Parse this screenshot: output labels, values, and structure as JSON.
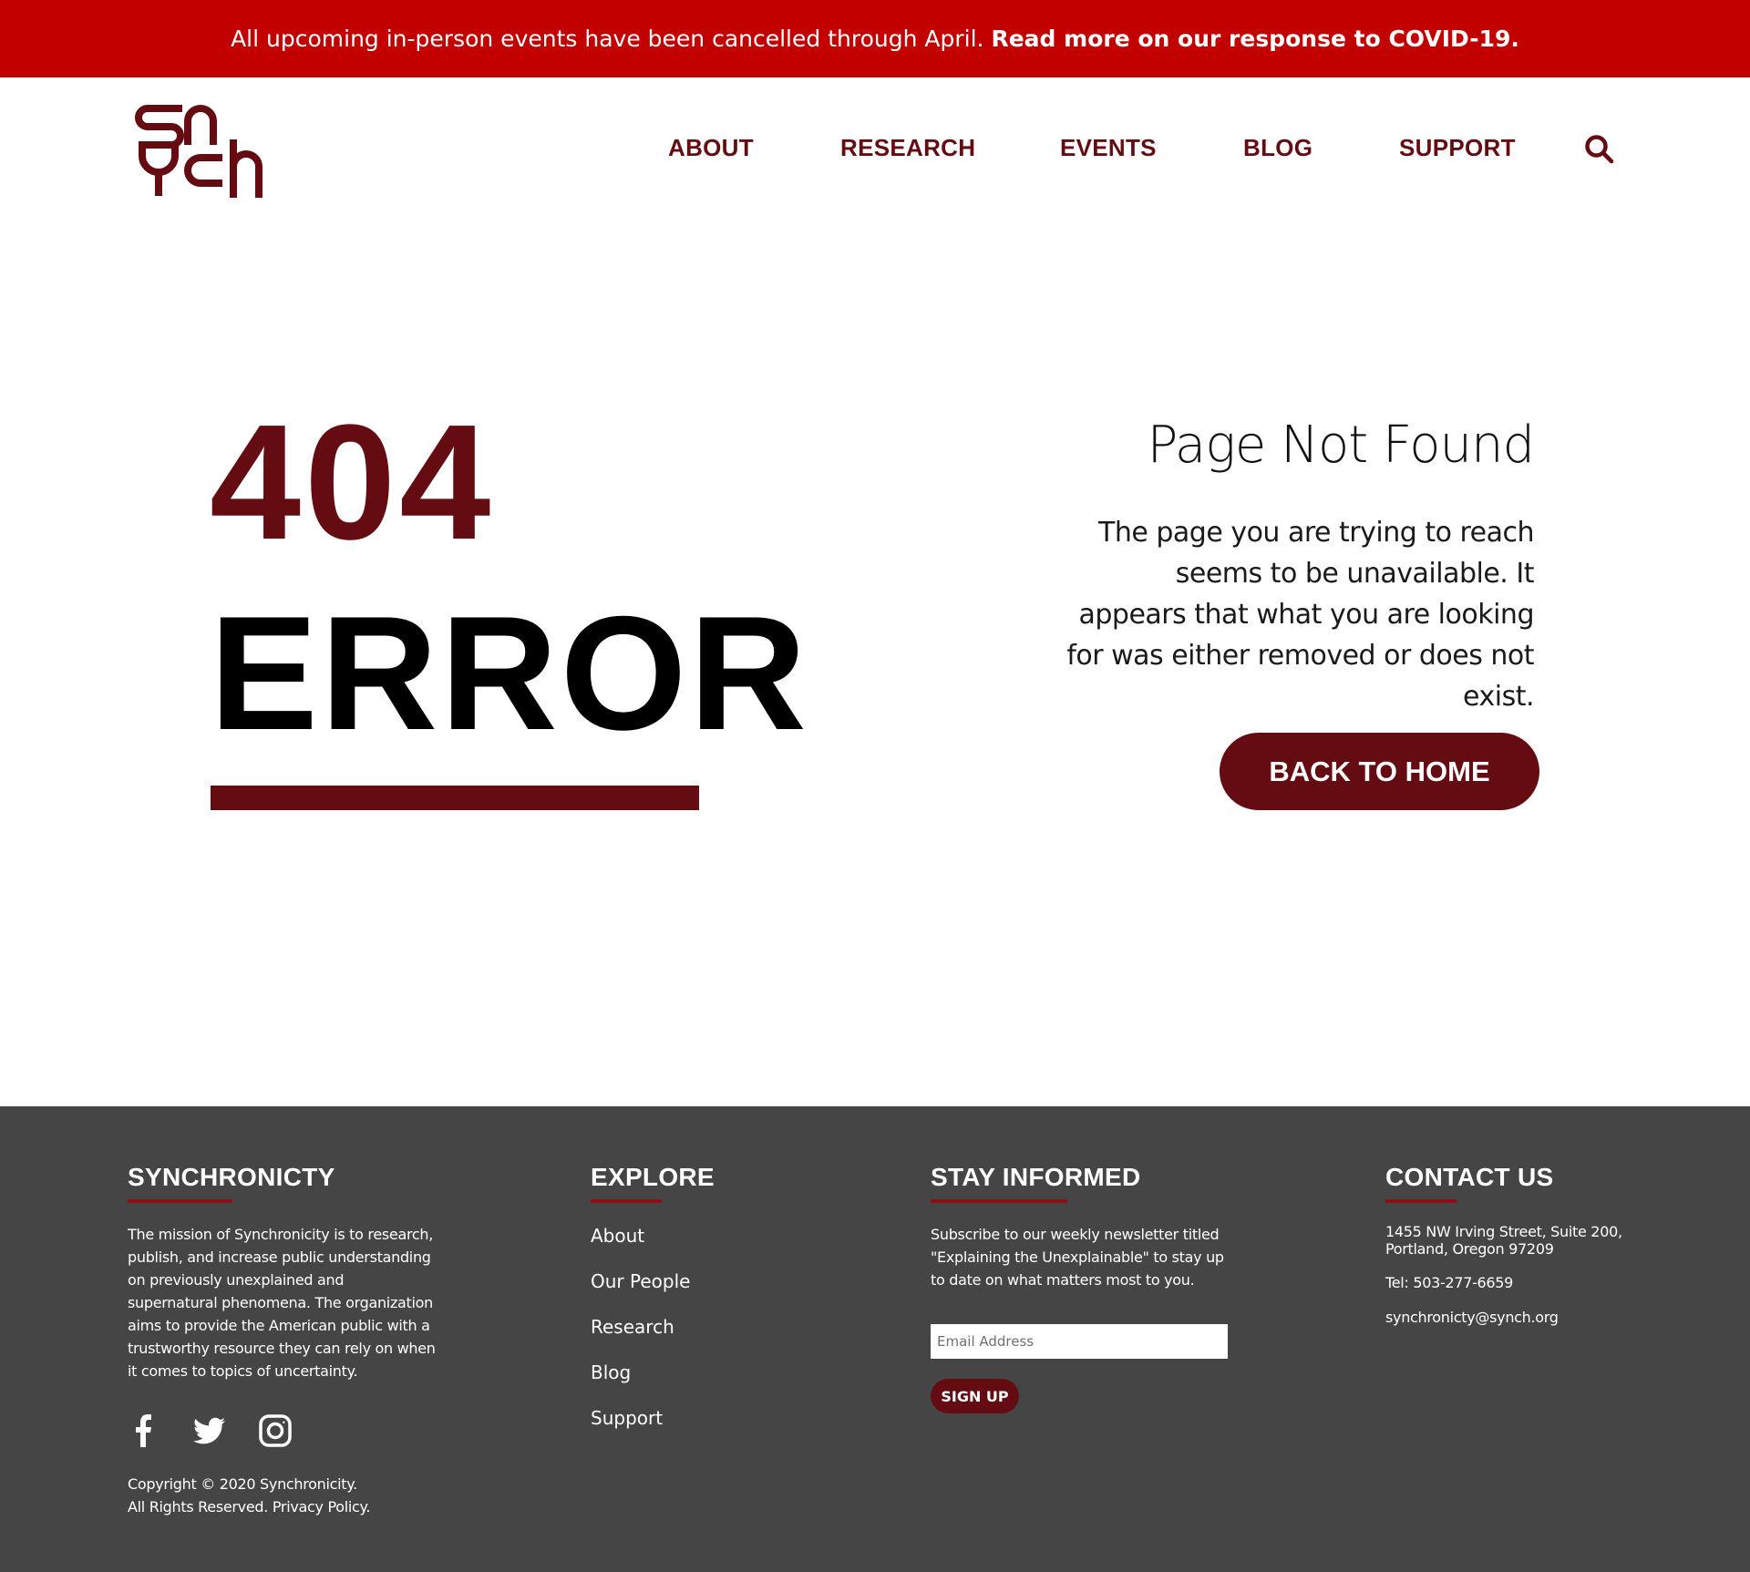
{
  "banner": {
    "message": "All upcoming in-person events have been cancelled through April.",
    "link": "Read more on our response to COVID-19."
  },
  "header": {
    "logo_alt": "Synch",
    "nav": [
      {
        "label": "ABOUT"
      },
      {
        "label": "RESEARCH"
      },
      {
        "label": "EVENTS"
      },
      {
        "label": "BLOG"
      },
      {
        "label": "SUPPORT"
      }
    ],
    "search_icon": "search-icon"
  },
  "main": {
    "code": "404",
    "word": "ERROR",
    "title": "Page Not Found",
    "text": "The page you are trying to reach seems to be unavailable. It appears that what you are looking for was either removed or does not exist.",
    "button": "BACK TO HOME"
  },
  "footer": {
    "synchronicity": {
      "heading": "SYNCHRONICTY",
      "text": "The mission of Synchronicity is to research, publish, and increase public understanding on previously unexplained and supernatural phenomena. The organization aims to provide the American public with a trustworthy resource they can rely on when it comes to topics of uncertainty.",
      "social": [
        "facebook-icon",
        "twitter-icon",
        "instagram-icon"
      ],
      "copyright_line1": "Copyright © 2020 Synchronicity.",
      "copyright_line2": "All Rights Reserved.",
      "privacy": "Privacy Policy",
      "privacy_suffix": "."
    },
    "explore": {
      "heading": "EXPLORE",
      "links": [
        "About",
        "Our People",
        "Research",
        "Blog",
        "Support"
      ]
    },
    "stay_informed": {
      "heading": "STAY INFORMED",
      "text": "Subscribe to our weekly newsletter titled \"Explaining the Unexplainable\" to stay up to date on what matters most to you.",
      "email_placeholder": "Email Address",
      "signup": "SIGN UP"
    },
    "contact": {
      "heading": "CONTACT US",
      "address_line1": "1455 NW Irving Street, Suite 200,",
      "address_line2": "Portland, Oregon 97209",
      "tel": "Tel: 503-277-6659",
      "email": "synchronicty@synch.org"
    }
  },
  "colors": {
    "banner": "#c20000",
    "brand": "#650b12",
    "footer_bg": "#454545",
    "footer_accent": "#8a1018"
  }
}
